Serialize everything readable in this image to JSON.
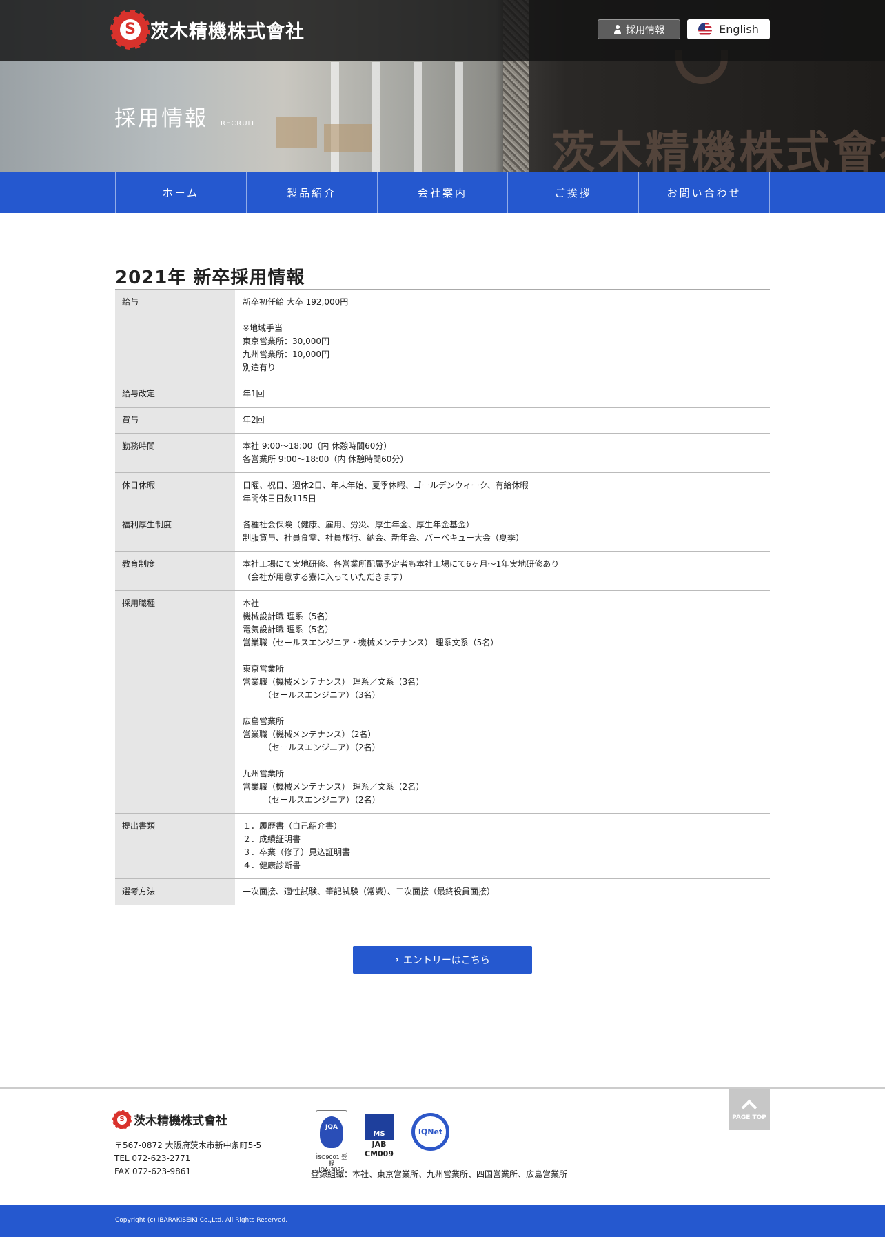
{
  "header": {
    "company_name": "茨木精機株式會社",
    "logo_mark": "S",
    "recruit_button": "採用情報",
    "english_button": "English",
    "page_title": "採用情報",
    "page_subtitle": "RECRUIT"
  },
  "nav": {
    "items": [
      {
        "label": "ホーム"
      },
      {
        "label": "製品紹介"
      },
      {
        "label": "会社案内"
      },
      {
        "label": "ご挨拶"
      },
      {
        "label": "お問い合わせ"
      }
    ]
  },
  "main": {
    "heading": "2021年 新卒採用情報",
    "rows": [
      {
        "label": "給与",
        "value": "新卒初任給 大卒 192,000円\n\n※地域手当\n東京営業所：30,000円\n九州営業所：10,000円\n別途有り"
      },
      {
        "label": "給与改定",
        "value": "年1回"
      },
      {
        "label": "賞与",
        "value": "年2回"
      },
      {
        "label": "勤務時間",
        "value": "本社 9:00〜18:00（内 休憩時間60分）\n各営業所 9:00〜18:00（内 休憩時間60分）"
      },
      {
        "label": "休日休暇",
        "value": "日曜、祝日、週休2日、年末年始、夏季休暇、ゴールデンウィーク、有給休暇\n年間休日日数115日"
      },
      {
        "label": "福利厚生制度",
        "value": "各種社会保険（健康、雇用、労災、厚生年金、厚生年金基金）\n制服貸与、社員食堂、社員旅行、納会、新年会、バーベキュー大会（夏季）"
      },
      {
        "label": "教育制度",
        "value": "本社工場にて実地研修、各営業所配属予定者も本社工場にて6ヶ月〜1年実地研修あり\n（会社が用意する寮に入っていただきます）"
      },
      {
        "label": "採用職種",
        "value": "本社\n機械設計職 理系（5名）\n電気設計職 理系（5名）\n営業職（セールスエンジニア・機械メンテナンス） 理系文系（5名）\n\n東京営業所\n営業職（機械メンテナンス） 理系／文系（3名）\n　　　（セールスエンジニア）（3名）\n\n広島営業所\n営業職（機械メンテナンス）（2名）\n　　　（セールスエンジニア）（2名）\n\n九州営業所\n営業職（機械メンテナンス） 理系／文系（2名）\n　　　（セールスエンジニア）（2名）\n"
      },
      {
        "label": "提出書類",
        "value": "１．履歴書（自己紹介書）\n２．成績証明書\n３．卒業（修了）見込証明書\n４．健康診断書"
      },
      {
        "label": "選考方法",
        "value": "一次面接、適性試験、筆記試験（常識）、二次面接（最終役員面接）"
      }
    ],
    "entry_button": "エントリーはこちら"
  },
  "footer": {
    "page_top": "PAGE TOP",
    "company_name": "茨木精機株式會社",
    "address": "〒567-0872 大阪府茨木市新中条町5-5",
    "tel": "TEL 072-623-2771",
    "fax": "FAX 072-623-9861",
    "cert_jqa_badge": "JQA",
    "cert_jqa_caption1": "ISO9001 登録",
    "cert_jqa_caption2": "JQA-3025",
    "cert_jab_badge": "MS",
    "cert_jab_label": "JAB",
    "cert_jab_code": "CM009",
    "cert_ionet": "IQNet",
    "registry": "登録組織：本社、東京営業所、九州営業所、四国営業所、広島営業所",
    "copyright": "Copyright (c) IBARAKISEIKI Co.,Ltd. All Rights Reserved."
  },
  "colors": {
    "brand_blue": "#2558cf",
    "logo_red": "#d9322c"
  }
}
